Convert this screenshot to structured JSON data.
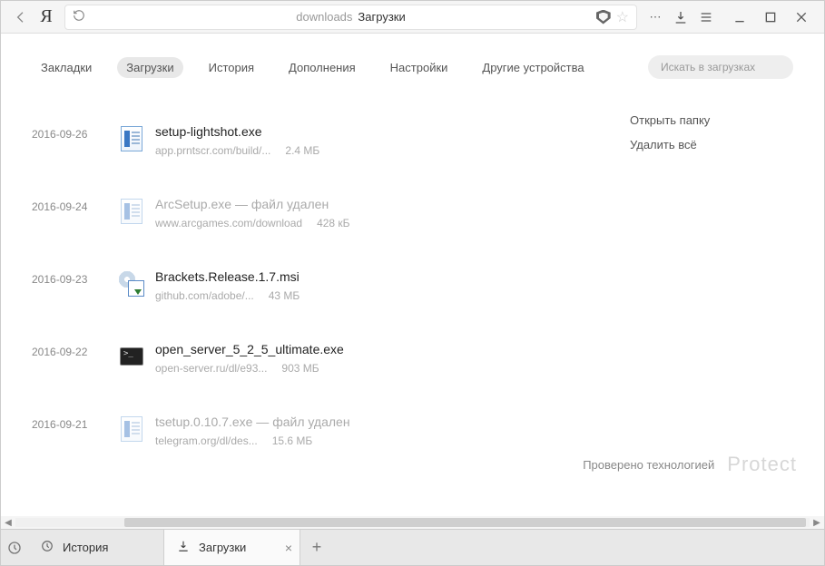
{
  "toolbar": {
    "logo": "Я",
    "address_label": "downloads",
    "address_title": "Загрузки"
  },
  "nav": {
    "tabs": [
      "Закладки",
      "Загрузки",
      "История",
      "Дополнения",
      "Настройки",
      "Другие устройства"
    ],
    "active_index": 1,
    "search_placeholder": "Искать в загрузках"
  },
  "side_actions": {
    "open_folder": "Открыть папку",
    "delete_all": "Удалить всё"
  },
  "downloads": [
    {
      "date": "2016-09-26",
      "name": "setup-lightshot.exe",
      "source": "app.prntscr.com/build/...",
      "size": "2.4 МБ",
      "deleted": false,
      "icon": "doc"
    },
    {
      "date": "2016-09-24",
      "name": "ArcSetup.exe — файл удален",
      "source": "www.arcgames.com/download",
      "size": "428 кБ",
      "deleted": true,
      "icon": "doc-faded"
    },
    {
      "date": "2016-09-23",
      "name": "Brackets.Release.1.7.msi",
      "source": "github.com/adobe/...",
      "size": "43 МБ",
      "deleted": false,
      "icon": "installer"
    },
    {
      "date": "2016-09-22",
      "name": "open_server_5_2_5_ultimate.exe",
      "source": "open-server.ru/dl/e93...",
      "size": "903 МБ",
      "deleted": false,
      "icon": "terminal"
    },
    {
      "date": "2016-09-21",
      "name": "tsetup.0.10.7.exe — файл удален",
      "source": "telegram.org/dl/des...",
      "size": "15.6 МБ",
      "deleted": true,
      "icon": "doc-faded"
    }
  ],
  "status": {
    "text": "Проверено технологией",
    "brand": "Protect"
  },
  "tabstrip": {
    "tabs": [
      {
        "label": "История",
        "icon": "history",
        "active": false,
        "closable": false
      },
      {
        "label": "Загрузки",
        "icon": "download",
        "active": true,
        "closable": true
      }
    ]
  }
}
